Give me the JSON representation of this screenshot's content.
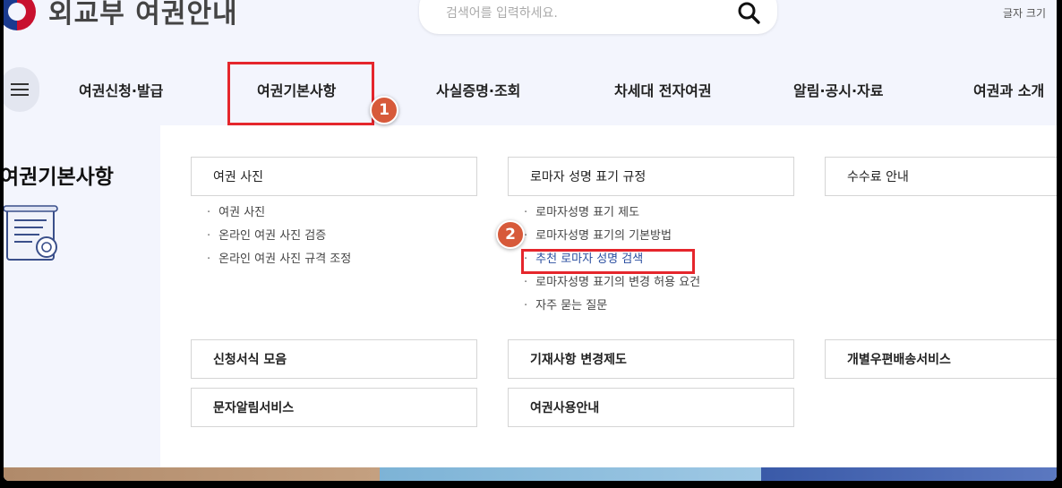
{
  "header": {
    "site_title": "외교부 여권안내",
    "search_placeholder": "검색어를 입력하세요.",
    "font_size_label": "글자 크기"
  },
  "nav": {
    "items": [
      "여권신청·발급",
      "여권기본사항",
      "사실증명·조회",
      "차세대 전자여권",
      "알림·공시·자료",
      "여권과 소개"
    ]
  },
  "section_title": "여권기본사항",
  "cards": {
    "photo": {
      "title": "여권 사진",
      "items": [
        "여권 사진",
        "온라인 여권 사진 검증",
        "온라인 여권 사진 규격 조정"
      ]
    },
    "romanization": {
      "title": "로마자 성명 표기 규정",
      "items": [
        "로마자성명 표기 제도",
        "로마자성명 표기의 기본방법",
        "추천 로마자 성명 검색",
        "로마자성명 표기의 변경 허용 요건",
        "자주 묻는 질문"
      ]
    },
    "fee": {
      "title": "수수료 안내"
    },
    "forms": {
      "title": "신청서식 모음"
    },
    "record_change": {
      "title": "기재사항 변경제도"
    },
    "postal": {
      "title": "개별우편배송서비스"
    },
    "sms": {
      "title": "문자알림서비스"
    },
    "usage": {
      "title": "여권사용안내"
    }
  },
  "annotations": [
    "1",
    "2"
  ],
  "colors": {
    "accent_red": "#e5262c",
    "badge": "#d75a3a",
    "link_blue": "#2a4ea0",
    "panel_bg": "#f3f5fd"
  },
  "icons": [
    "search-icon",
    "hamburger-menu-icon",
    "document-certificate-icon"
  ]
}
